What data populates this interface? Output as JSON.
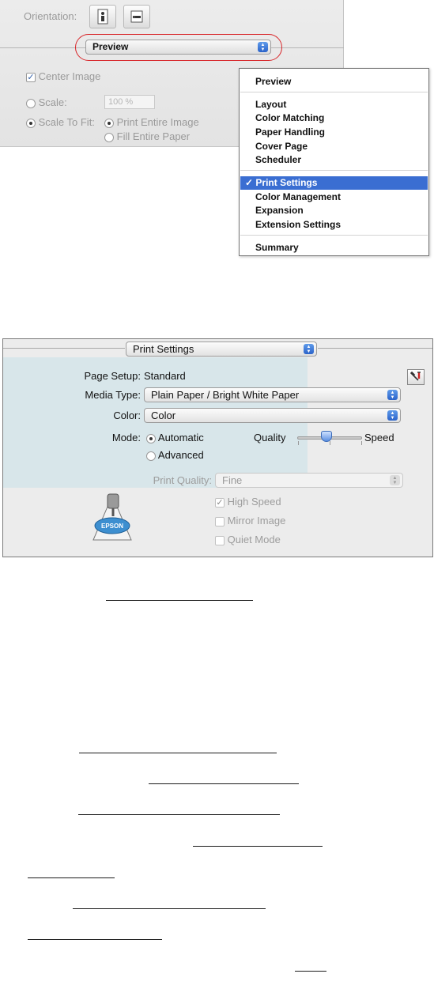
{
  "top_panel": {
    "orientation_label": "Orientation:",
    "preview_popup_value": "Preview",
    "center_image_label": "Center Image",
    "scale_label": "Scale:",
    "scale_value": "100 %",
    "scale_to_fit_label": "Scale To Fit:",
    "print_entire_image_label": "Print Entire Image",
    "fill_entire_paper_label": "Fill Entire Paper"
  },
  "menu": {
    "items_group1": [
      "Preview"
    ],
    "items_group2": [
      "Layout",
      "Color Matching",
      "Paper Handling",
      "Cover Page",
      "Scheduler"
    ],
    "selected_item": "Print Settings",
    "checkmark": "✓",
    "items_group3": [
      "Color Management",
      "Expansion",
      "Extension Settings"
    ],
    "items_group4": [
      "Summary"
    ]
  },
  "dialog": {
    "pane_popup_value": "Print Settings",
    "page_setup_label": "Page Setup:",
    "page_setup_value": "Standard",
    "media_type_label": "Media Type:",
    "media_type_value": "Plain Paper / Bright White Paper",
    "color_label": "Color:",
    "color_value": "Color",
    "mode_label": "Mode:",
    "mode_automatic": "Automatic",
    "mode_advanced": "Advanced",
    "quality_label": "Quality",
    "speed_label": "Speed",
    "print_quality_label": "Print Quality:",
    "print_quality_value": "Fine",
    "high_speed_label": "High Speed",
    "mirror_image_label": "Mirror Image",
    "quiet_mode_label": "Quiet Mode",
    "logo_text": "EPSON"
  },
  "colors": {
    "highlight": "#3a6ed2",
    "annotation_red": "#d8262a",
    "dialog_shade": "#d8e6ea"
  }
}
